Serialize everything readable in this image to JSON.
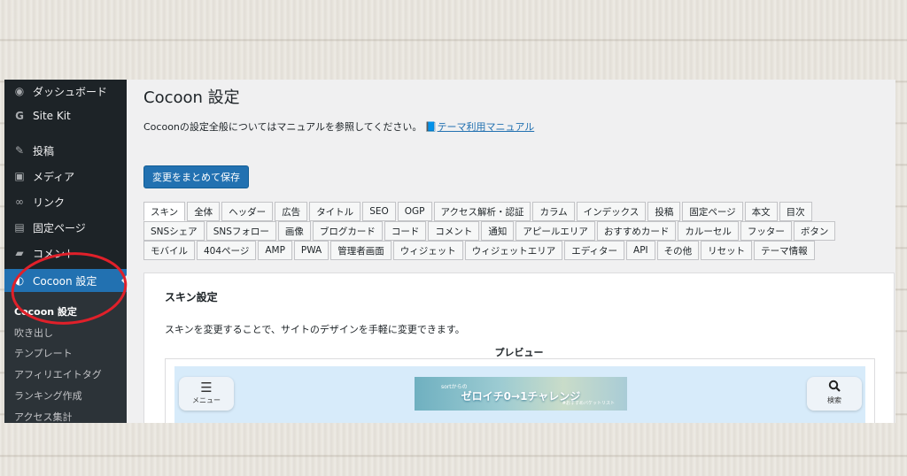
{
  "sidebar": {
    "items": [
      {
        "label": "ダッシュボード",
        "icon": "dashboard-icon",
        "glyph": "◉"
      },
      {
        "label": "Site Kit",
        "icon": "google-g-icon",
        "glyph": "G"
      },
      {
        "label": "投稿",
        "icon": "pin-icon",
        "glyph": "✎"
      },
      {
        "label": "メディア",
        "icon": "media-icon",
        "glyph": "▣"
      },
      {
        "label": "リンク",
        "icon": "link-icon",
        "glyph": "∞"
      },
      {
        "label": "固定ページ",
        "icon": "page-icon",
        "glyph": "▤"
      },
      {
        "label": "コメント",
        "icon": "comment-icon",
        "glyph": "▰"
      },
      {
        "label": "Cocoon 設定",
        "icon": "cocoon-icon",
        "glyph": "◐"
      }
    ],
    "submenu": [
      "Cocoon 設定",
      "吹き出し",
      "テンプレート",
      "アフィリエイトタグ",
      "ランキング作成",
      "アクセス集計"
    ]
  },
  "page": {
    "title": "Cocoon 設定",
    "intro": "Cocoonの設定全般についてはマニュアルを参照してください。",
    "manual_link": "テーマ利用マニュアル",
    "save_button": "変更をまとめて保存"
  },
  "tabs": {
    "row1": [
      "スキン",
      "全体",
      "ヘッダー",
      "広告",
      "タイトル",
      "SEO",
      "OGP",
      "アクセス解析・認証",
      "カラム",
      "インデックス",
      "投稿",
      "固定ページ",
      "本文",
      "目次"
    ],
    "row2": [
      "SNSシェア",
      "SNSフォロー",
      "画像",
      "ブログカード",
      "コード",
      "コメント",
      "通知",
      "アピールエリア",
      "おすすめカード",
      "カルーセル",
      "フッター",
      "ボタン"
    ],
    "row3": [
      "モバイル",
      "404ページ",
      "AMP",
      "PWA",
      "管理者画面",
      "ウィジェット",
      "ウィジェットエリア",
      "エディター",
      "API",
      "その他",
      "リセット",
      "テーマ情報"
    ]
  },
  "panel": {
    "heading": "スキン設定",
    "description": "スキンを変更することで、サイトのデザインを手軽に変更できます。",
    "preview_label": "プレビュー",
    "menu_label": "メニュー",
    "search_label": "検索",
    "banner_small": "sortからの",
    "banner_title": "ゼロイチ0→1チャレンジ",
    "banner_tiny": "#おすすめバケットリスト"
  },
  "colors": {
    "accent": "#2271b1",
    "sidebar_bg": "#1d2327",
    "annotation": "#e0202a"
  }
}
